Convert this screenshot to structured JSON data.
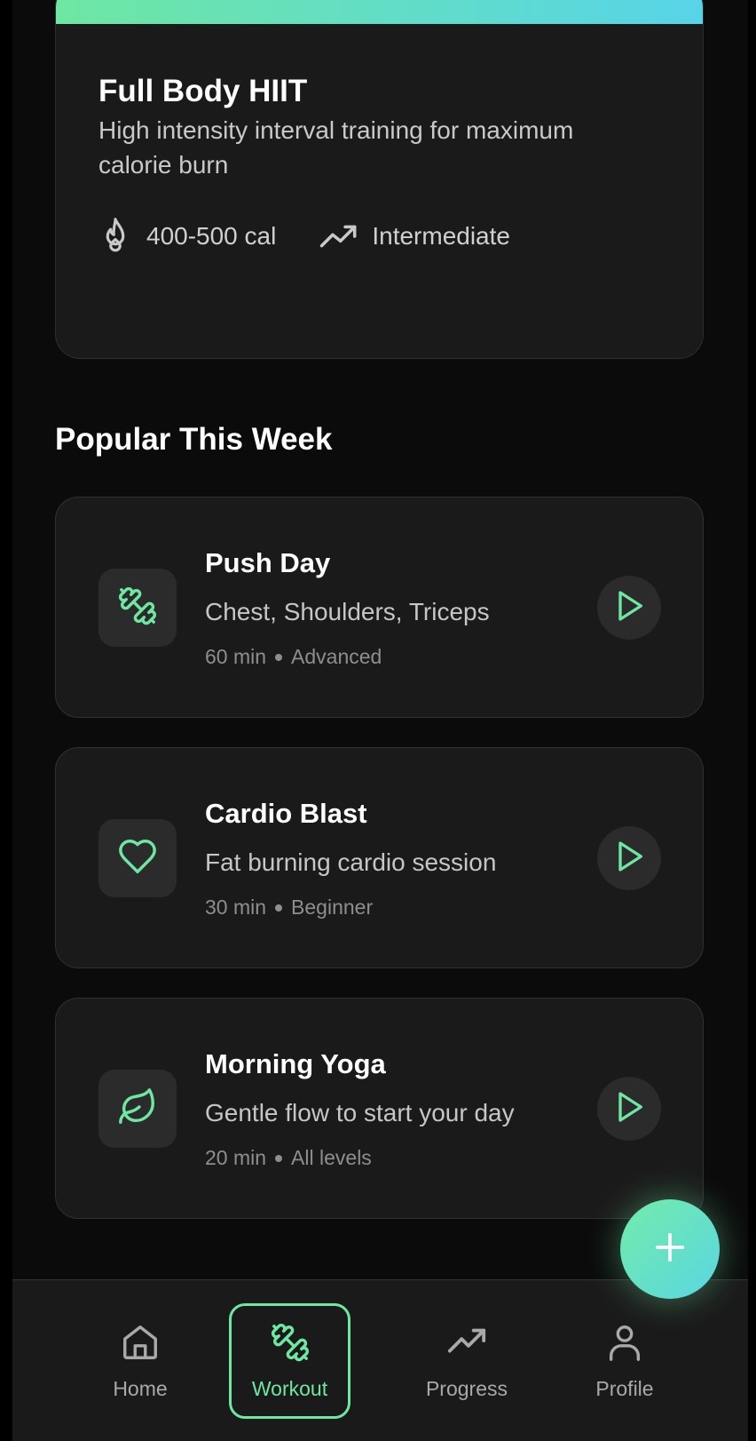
{
  "featured": {
    "title": "Full Body HIIT",
    "description": "High intensity interval training for maximum calorie burn",
    "calories": "400-500 cal",
    "level": "Intermediate",
    "banner_gradient": [
      "#6ee7a2",
      "#57d4e8"
    ]
  },
  "popular": {
    "heading": "Popular This Week",
    "items": [
      {
        "title": "Push Day",
        "subtitle": "Chest, Shoulders, Triceps",
        "duration": "60 min",
        "level": "Advanced",
        "icon": "dumbbell-icon"
      },
      {
        "title": "Cardio Blast",
        "subtitle": "Fat burning cardio session",
        "duration": "30 min",
        "level": "Beginner",
        "icon": "heart-icon"
      },
      {
        "title": "Morning Yoga",
        "subtitle": "Gentle flow to start your day",
        "duration": "20 min",
        "level": "All levels",
        "icon": "leaf-icon"
      }
    ]
  },
  "fab": {
    "icon": "plus-icon"
  },
  "nav": {
    "items": [
      {
        "label": "Home",
        "icon": "home-icon",
        "active": false
      },
      {
        "label": "Workout",
        "icon": "dumbbell-icon",
        "active": true
      },
      {
        "label": "Progress",
        "icon": "trending-up-icon",
        "active": false
      },
      {
        "label": "Profile",
        "icon": "user-icon",
        "active": false
      }
    ]
  },
  "colors": {
    "accent": "#6ee7a2",
    "accent_secondary": "#57d4e8",
    "card": "#1a1a1a",
    "background": "#0b0b0b"
  }
}
